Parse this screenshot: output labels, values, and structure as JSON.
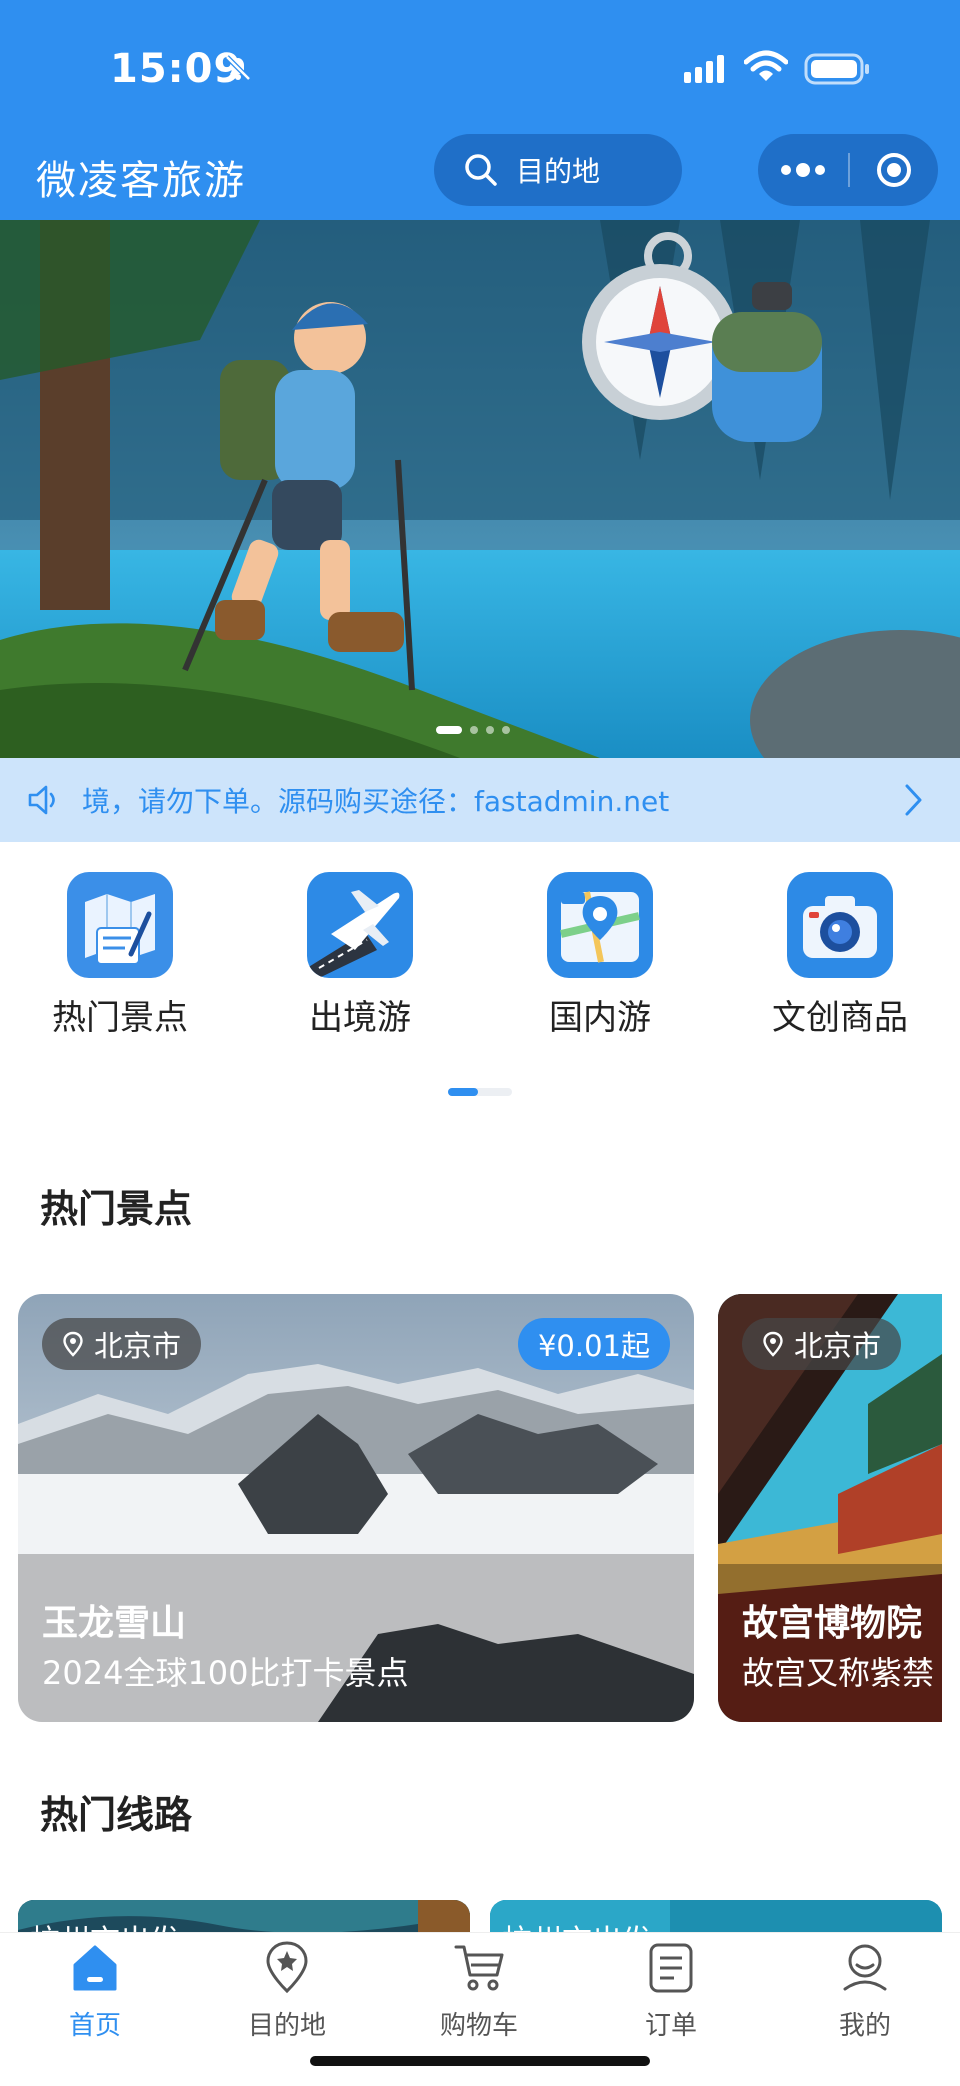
{
  "status_bar": {
    "time": "15:09"
  },
  "header": {
    "title": "微凌客旅游",
    "search_placeholder": "目的地"
  },
  "notice": {
    "text": "境，请勿下单。源码购买途径：fastadmin.net"
  },
  "categories": [
    {
      "label": "热门景点",
      "icon": "map-icon"
    },
    {
      "label": "出境游",
      "icon": "airplane-icon"
    },
    {
      "label": "国内游",
      "icon": "location-map-icon"
    },
    {
      "label": "文创商品",
      "icon": "camera-icon"
    }
  ],
  "hot_spots": {
    "title": "热门景点",
    "items": [
      {
        "location": "北京市",
        "price": "¥0.01起",
        "name": "玉龙雪山",
        "desc": "2024全球100比打卡景点"
      },
      {
        "location": "北京市",
        "name": "故宫博物院",
        "desc": "故宫又称紫禁"
      }
    ]
  },
  "hot_routes": {
    "title": "热门线路",
    "items": [
      {
        "label": "杭州市出发"
      },
      {
        "label": "杭州市出发"
      }
    ]
  },
  "tabbar": [
    {
      "label": "首页",
      "icon": "home-icon",
      "active": true
    },
    {
      "label": "目的地",
      "icon": "location-star-icon"
    },
    {
      "label": "购物车",
      "icon": "cart-icon"
    },
    {
      "label": "订单",
      "icon": "order-icon"
    },
    {
      "label": "我的",
      "icon": "user-icon"
    }
  ],
  "colors": {
    "primary": "#2f8ff0",
    "notice_bg": "#cde4fb"
  }
}
